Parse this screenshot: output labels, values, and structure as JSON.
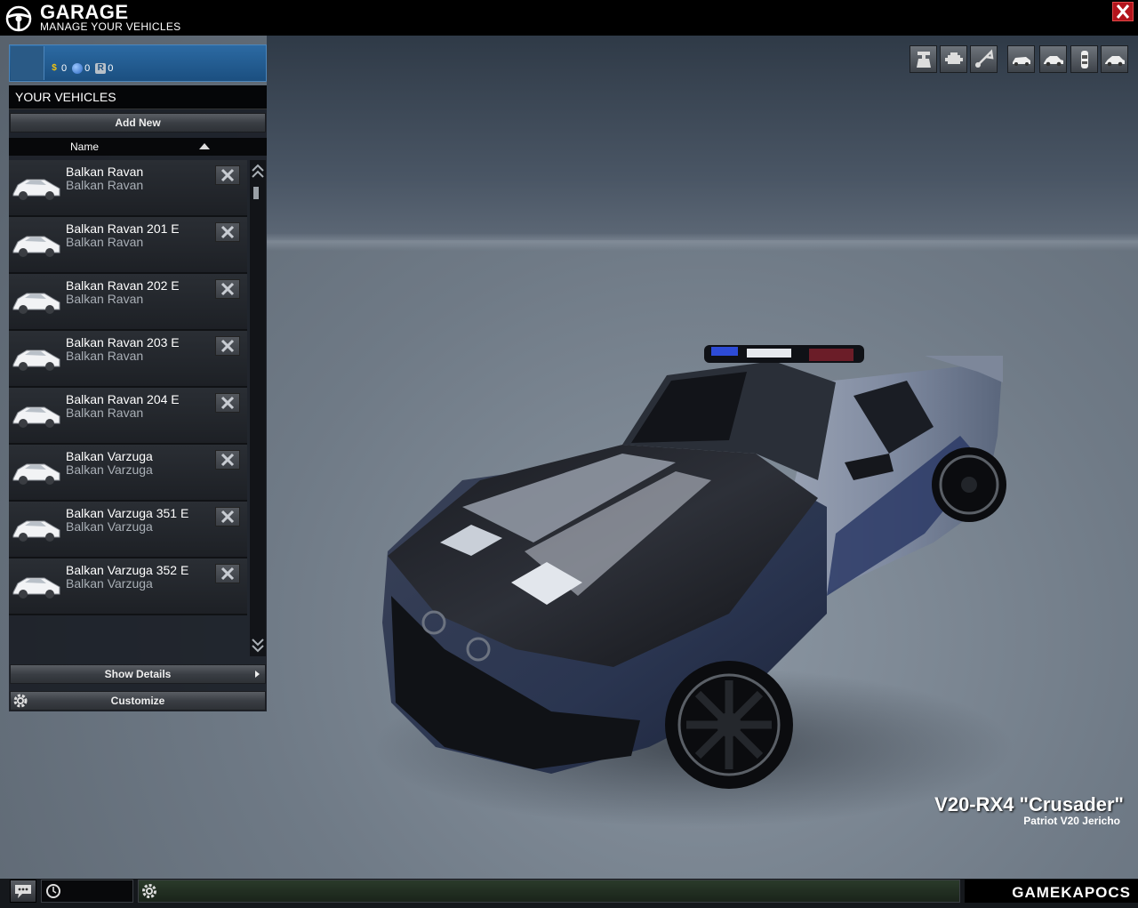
{
  "header": {
    "title": "GARAGE",
    "subtitle": "MANAGE YOUR VEHICLES",
    "close_icon": "close-icon"
  },
  "profile": {
    "currencies": [
      {
        "icon": "dollar-icon",
        "value": "0",
        "color": "#f2c40f"
      },
      {
        "icon": "orb-icon",
        "value": "0",
        "color": "#3c7fd6"
      },
      {
        "icon": "r-token-icon",
        "value": "0",
        "color": "#b8c0c8"
      }
    ]
  },
  "vehicles_panel": {
    "title": "YOUR VEHICLES",
    "add_new_label": "Add New",
    "column_name": "Name",
    "items": [
      {
        "name": "Balkan Ravan",
        "model": "Balkan Ravan"
      },
      {
        "name": "Balkan Ravan 201 E",
        "model": "Balkan Ravan"
      },
      {
        "name": "Balkan Ravan 202 E",
        "model": "Balkan Ravan"
      },
      {
        "name": "Balkan Ravan 203 E",
        "model": "Balkan Ravan"
      },
      {
        "name": "Balkan Ravan 204 E",
        "model": "Balkan Ravan"
      },
      {
        "name": "Balkan Varzuga",
        "model": "Balkan Varzuga"
      },
      {
        "name": "Balkan Varzuga 351 E",
        "model": "Balkan Varzuga"
      },
      {
        "name": "Balkan Varzuga 352 E",
        "model": "Balkan Varzuga"
      }
    ],
    "show_details_label": "Show Details",
    "customize_label": "Customize"
  },
  "toolbar": {
    "groups": [
      [
        "paint-icon",
        "engine-icon",
        "horn-icon"
      ],
      [
        "car-front-icon",
        "car-side-icon",
        "car-top-icon",
        "car-rear-icon"
      ]
    ]
  },
  "selected_vehicle": {
    "name": "V20-RX4 \"Crusader\"",
    "model": "Patriot V20 Jericho"
  },
  "footer": {
    "brand": "GAMEKAPOCS"
  },
  "colors": {
    "accent_blue": "#1b4f80",
    "close_red": "#b3141c"
  }
}
